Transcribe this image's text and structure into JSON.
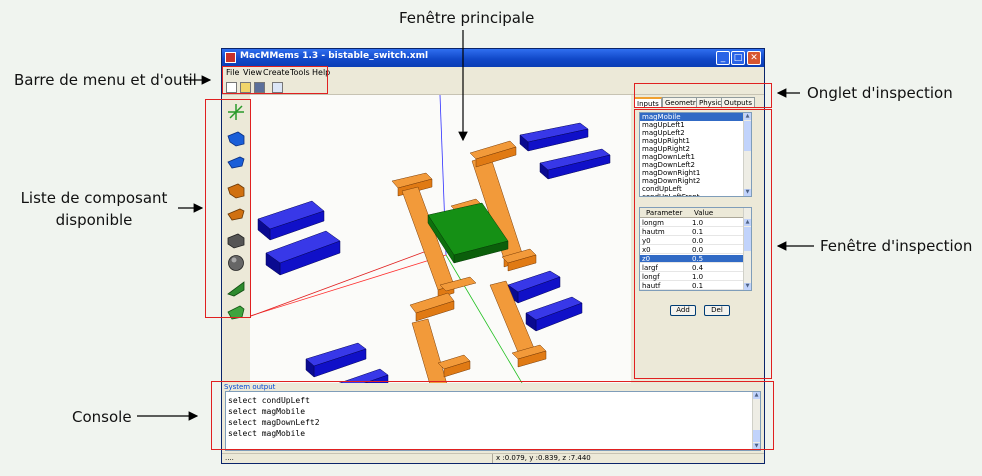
{
  "window": {
    "title": "MacMMems 1.3 - bistable_switch.xml",
    "controls": {
      "minimize": "_",
      "maximize": "□",
      "close": "✕"
    }
  },
  "menu": [
    "File",
    "View",
    "Create",
    "Tools",
    "Help"
  ],
  "toolbar_icons": [
    "new-file-icon",
    "open-folder-icon",
    "save-icon",
    "refresh-icon"
  ],
  "components": [
    {
      "icon": "axes-icon",
      "color": "#2a9a2a"
    },
    {
      "icon": "blue-curved-beam-icon",
      "color": "#1a5ed8"
    },
    {
      "icon": "blue-beam-icon",
      "color": "#1a5ed8"
    },
    {
      "icon": "orange-curved-beam-icon",
      "color": "#d07010"
    },
    {
      "icon": "orange-beam-icon",
      "color": "#d07010"
    },
    {
      "icon": "gray-block-icon",
      "color": "#555555"
    },
    {
      "icon": "gray-sphere-icon",
      "color": "#666666"
    },
    {
      "icon": "green-wedge-icon",
      "color": "#2e8b2e"
    },
    {
      "icon": "green-beam-icon",
      "color": "#3ea43e"
    }
  ],
  "inspector": {
    "tabs": [
      "Inputs",
      "Geometry",
      "Physic",
      "Outputs"
    ],
    "active_tab": "Inputs",
    "objects": [
      "magMobile",
      "magUpLeft1",
      "magUpLeft2",
      "magUpRight1",
      "magUpRight2",
      "magDownLeft1",
      "magDownLeft2",
      "magDownRight1",
      "magDownRight2",
      "condUpLeft",
      "condUpLeftFront"
    ],
    "selected_object": "magMobile",
    "table_headers": {
      "parameter": "Parameter",
      "value": "Value"
    },
    "parameters": [
      {
        "name": "longm",
        "value": "1.0"
      },
      {
        "name": "hautm",
        "value": "0.1"
      },
      {
        "name": "y0",
        "value": "0.0"
      },
      {
        "name": "x0",
        "value": "0.0"
      },
      {
        "name": "z0",
        "value": "0.5",
        "selected": true
      },
      {
        "name": "largf",
        "value": "0.4"
      },
      {
        "name": "longf",
        "value": "1.0"
      },
      {
        "name": "hautf",
        "value": "0.1"
      }
    ],
    "add_label": "Add",
    "del_label": "Del"
  },
  "console": {
    "label": "System output",
    "lines": [
      "select condUpLeft",
      "select magMobile",
      "select magDownLeft2",
      "select magMobile"
    ]
  },
  "status": {
    "left": "....",
    "coords": "x :0.079, y :0.839, z :7.440"
  },
  "callouts": {
    "main_window": "Fenêtre principale",
    "menu_toolbar": "Barre de menu et d'outil",
    "inspector_tab": "Onglet d'inspection",
    "components_line1": "Liste de composant",
    "components_line2": "disponible",
    "inspector_window": "Fenêtre d'inspection",
    "console": "Console"
  },
  "colors": {
    "magnet_blue": "#1010c8",
    "conductor_orange": "#e07a14",
    "mobile_green": "#138a13",
    "annotation_red": "#e02020",
    "titlebar_blue": "#1148c8"
  }
}
